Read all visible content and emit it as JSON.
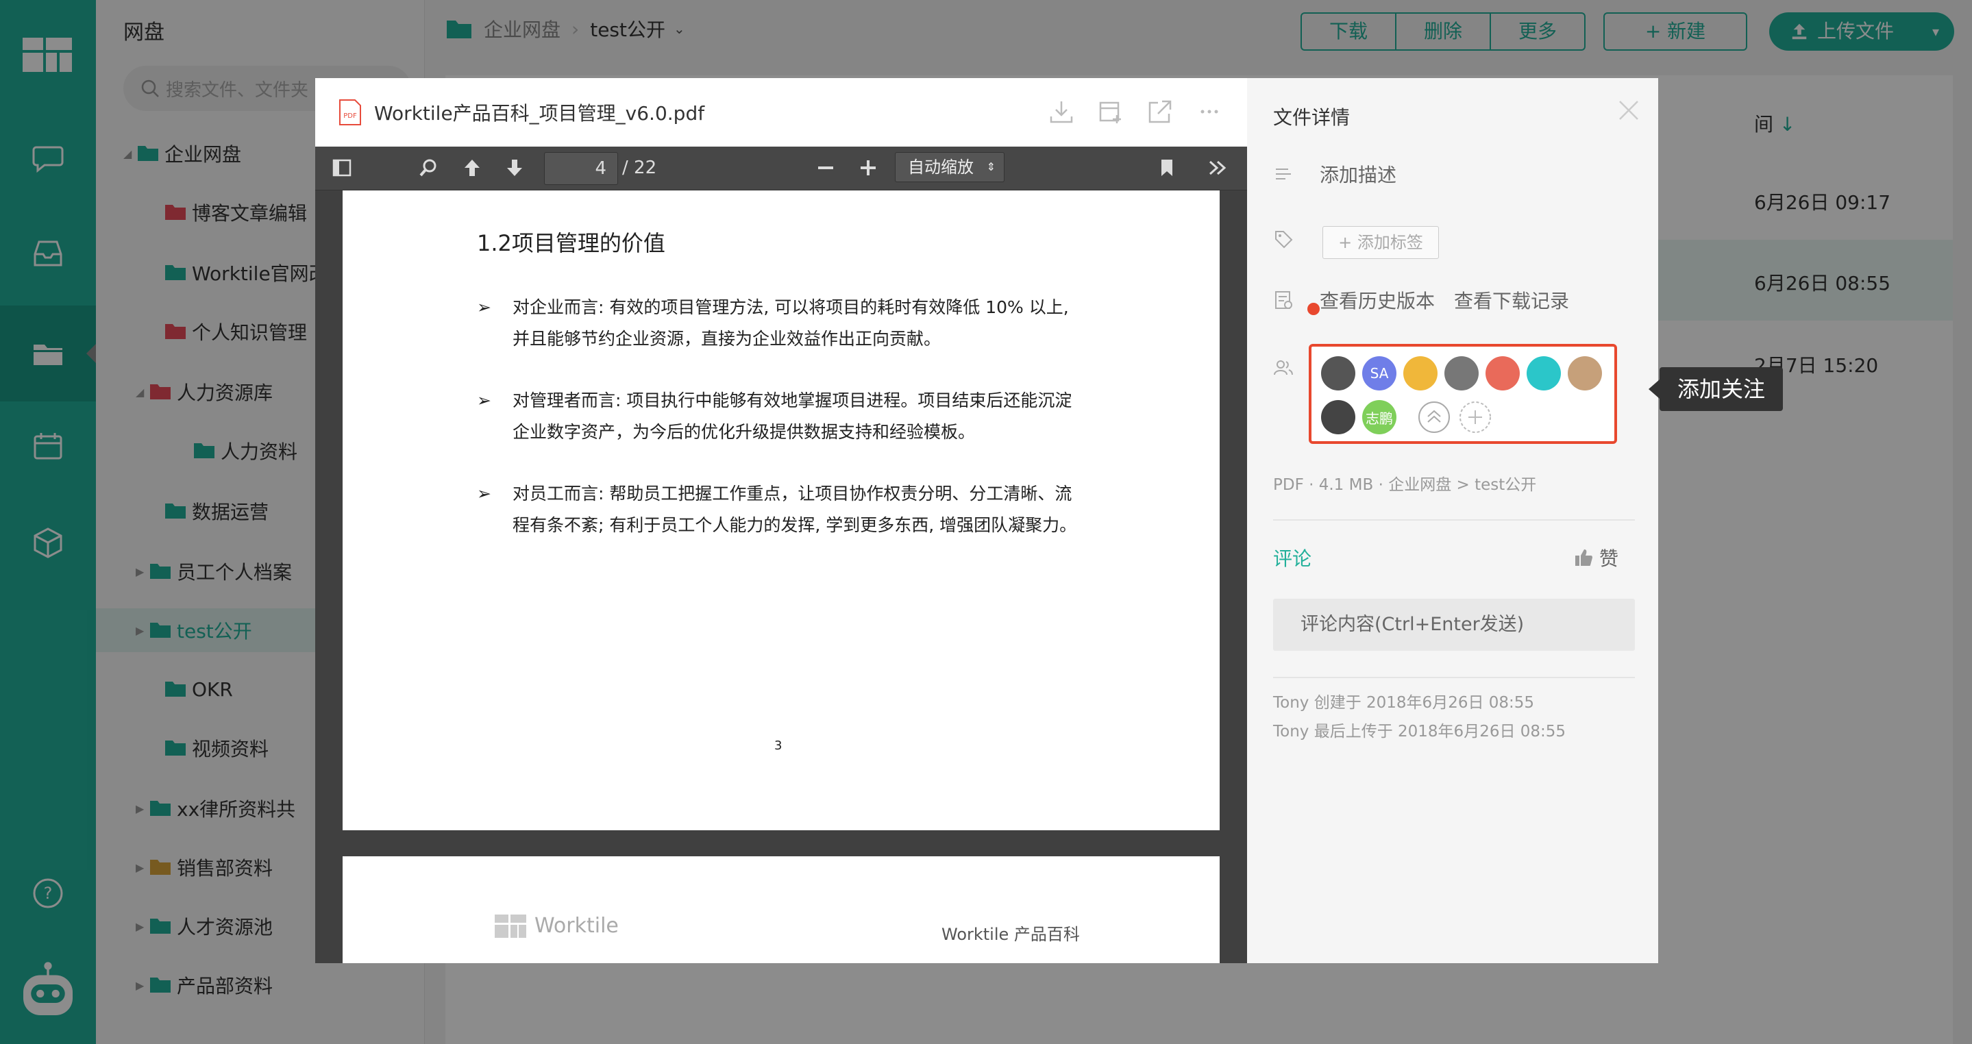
{
  "app": {
    "module_title": "网盘"
  },
  "tree": {
    "search_placeholder": "搜索文件、文件夹",
    "items": [
      {
        "label": "企业网盘",
        "color": "#22b09a"
      },
      {
        "label": "博客文章编辑",
        "color": "#e74c5a"
      },
      {
        "label": "Worktile官网改",
        "color": "#22b09a"
      },
      {
        "label": "个人知识管理",
        "color": "#e74c5a"
      },
      {
        "label": "人力资源库",
        "color": "#e74c5a"
      },
      {
        "label": "人力资料",
        "color": "#22b09a"
      },
      {
        "label": "数据运营",
        "color": "#22b09a"
      },
      {
        "label": "员工个人档案",
        "color": "#22b09a"
      },
      {
        "label": "test公开",
        "color": "#22b09a"
      },
      {
        "label": "OKR",
        "color": "#22b09a"
      },
      {
        "label": "视频资料",
        "color": "#22b09a"
      },
      {
        "label": "xx律所资料共",
        "color": "#22b09a"
      },
      {
        "label": "销售部资料",
        "color": "#d9a53b"
      },
      {
        "label": "人才资源池",
        "color": "#22b09a"
      },
      {
        "label": "产品部资料",
        "color": "#22b09a"
      }
    ]
  },
  "header": {
    "breadcrumb_root": "企业网盘",
    "breadcrumb_current": "test公开",
    "actions": [
      "下载",
      "删除",
      "更多"
    ],
    "new_label": "+ 新建",
    "upload_label": "上传文件"
  },
  "list": {
    "sort_col": "间",
    "rows": [
      "6月26日 09:17",
      "6月26日 08:55",
      "2月7日 15:20"
    ]
  },
  "viewer": {
    "filename": "Worktile产品百科_项目管理_v6.0.pdf",
    "page_current": "4",
    "page_total": "/ 22",
    "zoom": "自动缩放",
    "page": {
      "heading": "1.2项目管理的价值",
      "bullet_glyph": "➢",
      "paragraphs": [
        [
          "对企业而言: 有效的项目管理方法, 可以将项目的耗时有效降低 10% 以上,",
          "并且能够节约企业资源，直接为企业效益作出正向贡献。"
        ],
        [
          "对管理者而言: 项目执行中能够有效地掌握项目进程。项目结束后还能沉淀",
          "企业数字资产，为今后的优化升级提供数据支持和经验模板。"
        ],
        [
          "对员工而言: 帮助员工把握工作重点，让项目协作权责分明、分工清晰、流",
          "程有条不紊; 有利于员工个人能力的发挥, 学到更多东西, 增强团队凝聚力。"
        ]
      ],
      "page_number": "3"
    },
    "next_page": {
      "logo_text": "Worktile",
      "header_right": "Worktile 产品百科"
    }
  },
  "detail": {
    "title": "文件详情",
    "add_desc": "添加描述",
    "add_tag": "+ 添加标签",
    "history": "查看历史版本",
    "downloads": "查看下载记录",
    "followers": [
      {
        "initials": "",
        "color": "#555555"
      },
      {
        "initials": "SA",
        "color": "#6f7ee8"
      },
      {
        "initials": "",
        "color": "#f0b73a"
      },
      {
        "initials": "",
        "color": "#777777"
      },
      {
        "initials": "",
        "color": "#e96a5a"
      },
      {
        "initials": "",
        "color": "#2bc6c9"
      },
      {
        "initials": "",
        "color": "#c6a07a"
      },
      {
        "initials": "",
        "color": "#444444"
      },
      {
        "initials": "志鹏",
        "color": "#7fcf5a"
      }
    ],
    "callout": "添加关注",
    "meta": "PDF · 4.1 MB · 企业网盘  > test公开",
    "comment_tab": "评论",
    "like": "赞",
    "comment_placeholder": "评论内容(Ctrl+Enter发送)",
    "created": "Tony 创建于 2018年6月26日 08:55",
    "updated": "Tony 最后上传于 2018年6月26日 08:55"
  }
}
